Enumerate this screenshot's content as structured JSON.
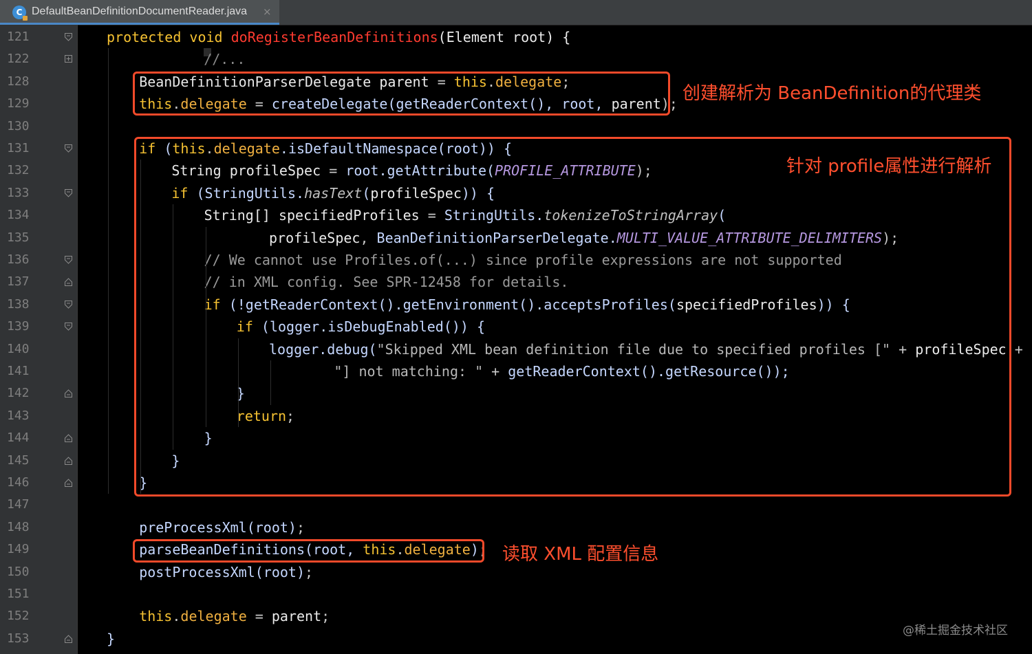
{
  "tab": {
    "title": "DefaultBeanDefinitionDocumentReader.java",
    "icon": "java-class-icon",
    "close": "×"
  },
  "annotations": {
    "box1": "创建解析为 BeanDefinition的代理类",
    "box2": "针对 profile属性进行解析",
    "box3": "读取 XML 配置信息"
  },
  "watermark": "@稀土掘金技术社区",
  "colors": {
    "keyword": "#f6c232",
    "method_decl": "#ff3b30",
    "annotation_box": "#f24a2a",
    "comment": "#9a9a9a",
    "constant": "#b698e0"
  },
  "lines": [
    {
      "n": "121",
      "indent": 0,
      "fold": "open",
      "t": [
        [
          "kw",
          "protected void "
        ],
        [
          "fn",
          "doRegisterBeanDefinitions"
        ],
        [
          "pl",
          "(Element root) {"
        ]
      ]
    },
    {
      "n": "122",
      "indent": 1,
      "fold": "plus",
      "t": [
        [
          "fold",
          "//..."
        ]
      ]
    },
    {
      "n": "128",
      "indent": 1,
      "fold": "",
      "t": [
        [
          "cl",
          "BeanDefinitionParserDelegate "
        ],
        [
          "pl",
          "parent "
        ],
        [
          "pu",
          "= "
        ],
        [
          "kw",
          "this"
        ],
        [
          "pu",
          "."
        ],
        [
          "fd",
          "delegate"
        ],
        [
          "pu",
          ";"
        ]
      ]
    },
    {
      "n": "129",
      "indent": 1,
      "fold": "",
      "t": [
        [
          "kw",
          "this"
        ],
        [
          "pu",
          "."
        ],
        [
          "fd",
          "delegate "
        ],
        [
          "pu",
          "= "
        ],
        [
          "mc",
          "createDelegate(getReaderContext(), root, "
        ],
        [
          "pl",
          "parent"
        ],
        [
          "pu",
          ");"
        ]
      ]
    },
    {
      "n": "130",
      "indent": 1,
      "fold": "",
      "t": []
    },
    {
      "n": "131",
      "indent": 1,
      "fold": "open",
      "t": [
        [
          "kw",
          "if "
        ],
        [
          "mc",
          "("
        ],
        [
          "kw",
          "this"
        ],
        [
          "pu",
          "."
        ],
        [
          "fd",
          "delegate"
        ],
        [
          "mc",
          ".isDefaultNamespace(root)) {"
        ]
      ]
    },
    {
      "n": "132",
      "indent": 2,
      "fold": "",
      "t": [
        [
          "cl",
          "String "
        ],
        [
          "pl",
          "profileSpec "
        ],
        [
          "pu",
          "= "
        ],
        [
          "mc",
          "root.getAttribute("
        ],
        [
          "cst",
          "PROFILE_ATTRIBUTE"
        ],
        [
          "pu",
          ");"
        ]
      ]
    },
    {
      "n": "133",
      "indent": 2,
      "fold": "open",
      "t": [
        [
          "kw",
          "if "
        ],
        [
          "mc",
          "(StringUtils."
        ],
        [
          "st",
          "hasText"
        ],
        [
          "mc",
          "("
        ],
        [
          "pl",
          "profileSpec"
        ],
        [
          "mc",
          ")) {"
        ]
      ]
    },
    {
      "n": "134",
      "indent": 3,
      "fold": "",
      "t": [
        [
          "cl",
          "String[] "
        ],
        [
          "pl",
          "specifiedProfiles "
        ],
        [
          "pu",
          "= "
        ],
        [
          "mc",
          "StringUtils."
        ],
        [
          "st",
          "tokenizeToStringArray"
        ],
        [
          "mc",
          "("
        ]
      ]
    },
    {
      "n": "135",
      "indent": 5,
      "fold": "",
      "t": [
        [
          "pl",
          "profileSpec"
        ],
        [
          "pu",
          ", "
        ],
        [
          "mc",
          "BeanDefinitionParserDelegate."
        ],
        [
          "cst",
          "MULTI_VALUE_ATTRIBUTE_DELIMITERS"
        ],
        [
          "pu",
          ");"
        ]
      ]
    },
    {
      "n": "136",
      "indent": 3,
      "fold": "open",
      "t": [
        [
          "cm",
          "// We cannot use Profiles.of(...) since profile expressions are not supported"
        ]
      ]
    },
    {
      "n": "137",
      "indent": 3,
      "fold": "close",
      "t": [
        [
          "cm",
          "// in XML config. See SPR-12458 for details."
        ]
      ]
    },
    {
      "n": "138",
      "indent": 3,
      "fold": "open",
      "t": [
        [
          "kw",
          "if "
        ],
        [
          "mc",
          "(!getReaderContext().getEnvironment().acceptsProfiles("
        ],
        [
          "pl",
          "specifiedProfiles"
        ],
        [
          "mc",
          ")) {"
        ]
      ]
    },
    {
      "n": "139",
      "indent": 4,
      "fold": "open",
      "t": [
        [
          "kw",
          "if "
        ],
        [
          "mc",
          "(logger.isDebugEnabled()) {"
        ]
      ]
    },
    {
      "n": "140",
      "indent": 5,
      "fold": "",
      "t": [
        [
          "mc",
          "logger.debug("
        ],
        [
          "str",
          "\"Skipped XML bean definition file due to specified profiles [\" "
        ],
        [
          "pu",
          "+ "
        ],
        [
          "pl",
          "profileSpec "
        ],
        [
          "pu",
          "+"
        ]
      ]
    },
    {
      "n": "141",
      "indent": 7,
      "fold": "",
      "t": [
        [
          "str",
          "\"] not matching: \" "
        ],
        [
          "pu",
          "+ "
        ],
        [
          "mc",
          "getReaderContext().getResource());"
        ]
      ]
    },
    {
      "n": "142",
      "indent": 4,
      "fold": "close",
      "t": [
        [
          "mc",
          "}"
        ]
      ]
    },
    {
      "n": "143",
      "indent": 4,
      "fold": "",
      "t": [
        [
          "kw",
          "return"
        ],
        [
          "pu",
          ";"
        ]
      ]
    },
    {
      "n": "144",
      "indent": 3,
      "fold": "close",
      "t": [
        [
          "mc",
          "}"
        ]
      ]
    },
    {
      "n": "145",
      "indent": 2,
      "fold": "close",
      "t": [
        [
          "mc",
          "}"
        ]
      ]
    },
    {
      "n": "146",
      "indent": 1,
      "fold": "close",
      "t": [
        [
          "mc",
          "}"
        ]
      ]
    },
    {
      "n": "147",
      "indent": 1,
      "fold": "",
      "t": []
    },
    {
      "n": "148",
      "indent": 1,
      "fold": "",
      "t": [
        [
          "mc",
          "preProcessXml(root)"
        ],
        [
          "pu",
          ";"
        ]
      ]
    },
    {
      "n": "149",
      "indent": 1,
      "fold": "",
      "t": [
        [
          "mc",
          "parseBeanDefinitions(root, "
        ],
        [
          "kw",
          "this"
        ],
        [
          "pu",
          "."
        ],
        [
          "fd",
          "delegate"
        ],
        [
          "mc",
          ")"
        ],
        [
          "pu",
          ";"
        ]
      ]
    },
    {
      "n": "150",
      "indent": 1,
      "fold": "",
      "t": [
        [
          "mc",
          "postProcessXml(root)"
        ],
        [
          "pu",
          ";"
        ]
      ]
    },
    {
      "n": "151",
      "indent": 1,
      "fold": "",
      "t": []
    },
    {
      "n": "152",
      "indent": 1,
      "fold": "",
      "t": [
        [
          "kw",
          "this"
        ],
        [
          "pu",
          "."
        ],
        [
          "fd",
          "delegate "
        ],
        [
          "pu",
          "= "
        ],
        [
          "pl",
          "parent"
        ],
        [
          "pu",
          ";"
        ]
      ]
    },
    {
      "n": "153",
      "indent": 0,
      "fold": "close",
      "t": [
        [
          "mc",
          "}"
        ]
      ]
    }
  ]
}
